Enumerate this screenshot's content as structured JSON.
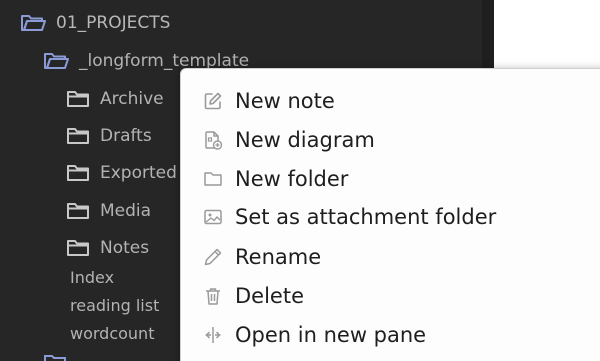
{
  "file_tree": {
    "root_folder": "01_PROJECTS",
    "sub_folder": "_longform_template",
    "folders": [
      "Archive",
      "Drafts",
      "Exported",
      "Media",
      "Notes"
    ],
    "files": [
      "Index",
      "reading list",
      "wordcount"
    ]
  },
  "context_menu": {
    "items": [
      {
        "label": "New note",
        "icon": "pencil-square-icon"
      },
      {
        "label": "New diagram",
        "icon": "diagram-file-icon"
      },
      {
        "label": "New folder",
        "icon": "folder-icon"
      },
      {
        "label": "Set as attachment folder",
        "icon": "image-icon"
      },
      {
        "label": "Rename",
        "icon": "pencil-icon"
      },
      {
        "label": "Delete",
        "icon": "trash-icon"
      },
      {
        "label": "Open in new pane",
        "icon": "split-pane-icon"
      }
    ]
  },
  "colors": {
    "sidebar_bg": "#262626",
    "sidebar_text": "#b3b3b3",
    "folder_icon_open": "#8a9bd6",
    "menu_bg": "#fdfdfd",
    "menu_text": "#1e1e1e",
    "menu_icon": "#9a9a9a"
  }
}
